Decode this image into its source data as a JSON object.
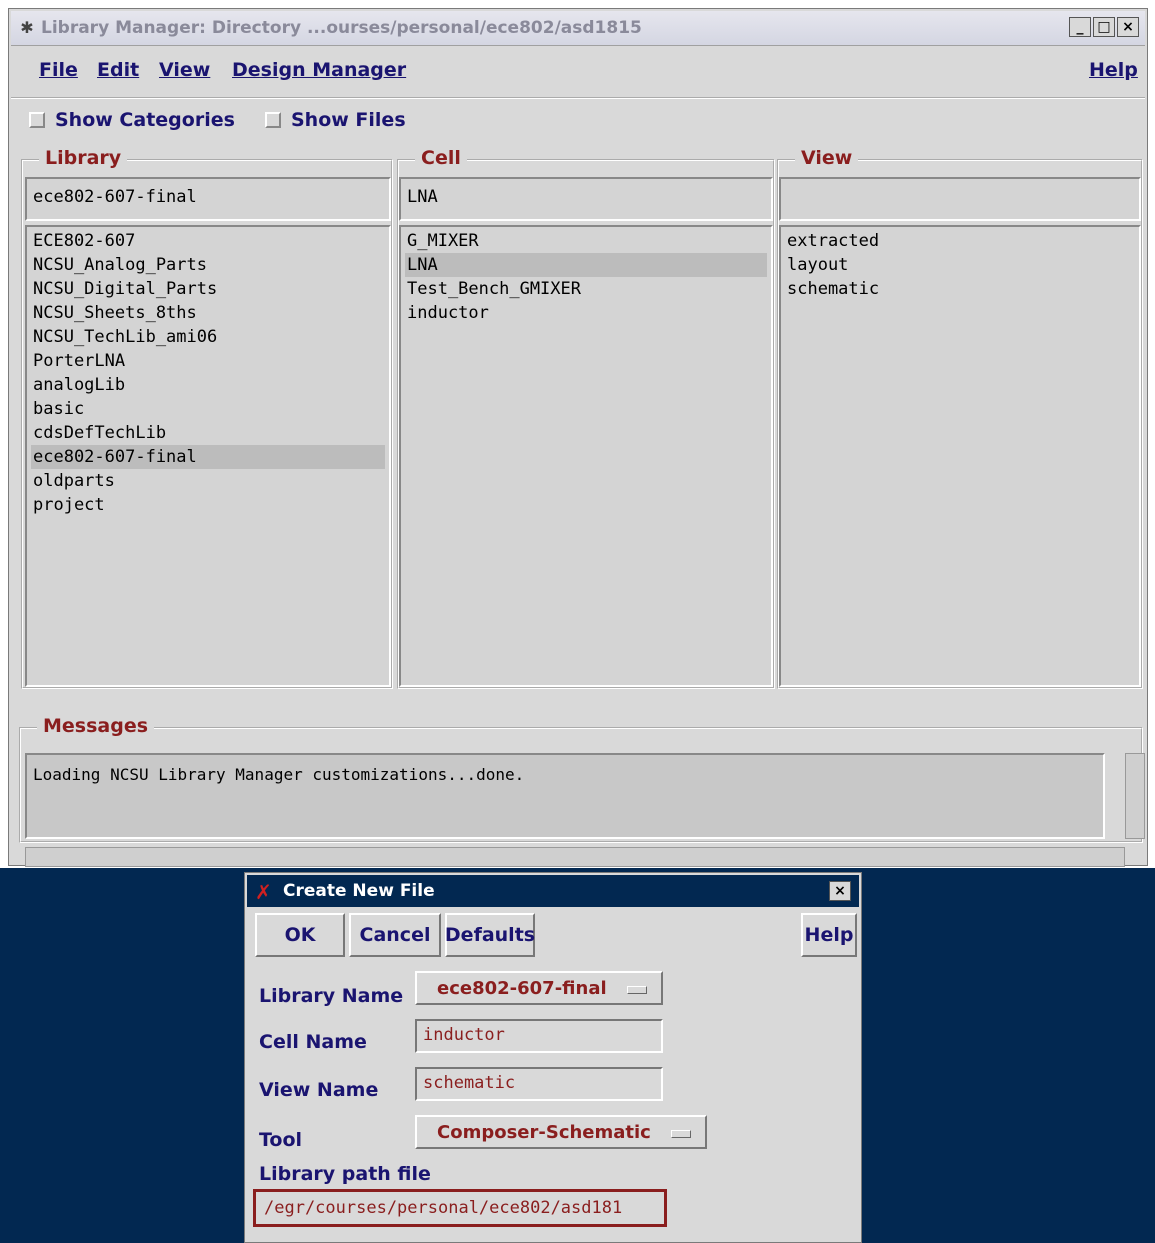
{
  "window": {
    "title": "Library Manager: Directory ...ourses/personal/ece802/asd1815",
    "controls": [
      "_",
      "□",
      "×"
    ]
  },
  "menu": {
    "file": "File",
    "edit": "Edit",
    "view": "View",
    "design_manager": "Design Manager",
    "help": "Help"
  },
  "options": {
    "show_categories": "Show Categories",
    "show_files": "Show Files"
  },
  "library": {
    "label": "Library",
    "entry": "ece802-607-final",
    "items": [
      "ECE802-607",
      "NCSU_Analog_Parts",
      "NCSU_Digital_Parts",
      "NCSU_Sheets_8ths",
      "NCSU_TechLib_ami06",
      "PorterLNA",
      "analogLib",
      "basic",
      "cdsDefTechLib",
      "ece802-607-final",
      "oldparts",
      "project"
    ],
    "selected": "ece802-607-final"
  },
  "cell": {
    "label": "Cell",
    "entry": "LNA",
    "items": [
      "G_MIXER",
      "LNA",
      "Test_Bench_GMIXER",
      "inductor"
    ],
    "selected": "LNA"
  },
  "view": {
    "label": "View",
    "entry": "",
    "items": [
      "extracted",
      "layout",
      "schematic"
    ]
  },
  "messages": {
    "label": "Messages",
    "text": "Loading NCSU Library Manager customizations...done."
  },
  "dialog": {
    "title": "Create New File",
    "close": "×",
    "ok": "OK",
    "cancel": "Cancel",
    "defaults": "Defaults",
    "help": "Help",
    "library_name_label": "Library Name",
    "library_name_value": "ece802-607-final",
    "cell_name_label": "Cell Name",
    "cell_name_value": "inductor",
    "view_name_label": "View Name",
    "view_name_value": "schematic",
    "tool_label": "Tool",
    "tool_value": "Composer-Schematic",
    "library_path_label": "Library path file",
    "library_path_value": "/egr/courses/personal/ece802/asd181"
  },
  "colors": {
    "title_blue": "#022851",
    "label_red": "#8a1e1e",
    "menu_blue": "#1a1470"
  }
}
